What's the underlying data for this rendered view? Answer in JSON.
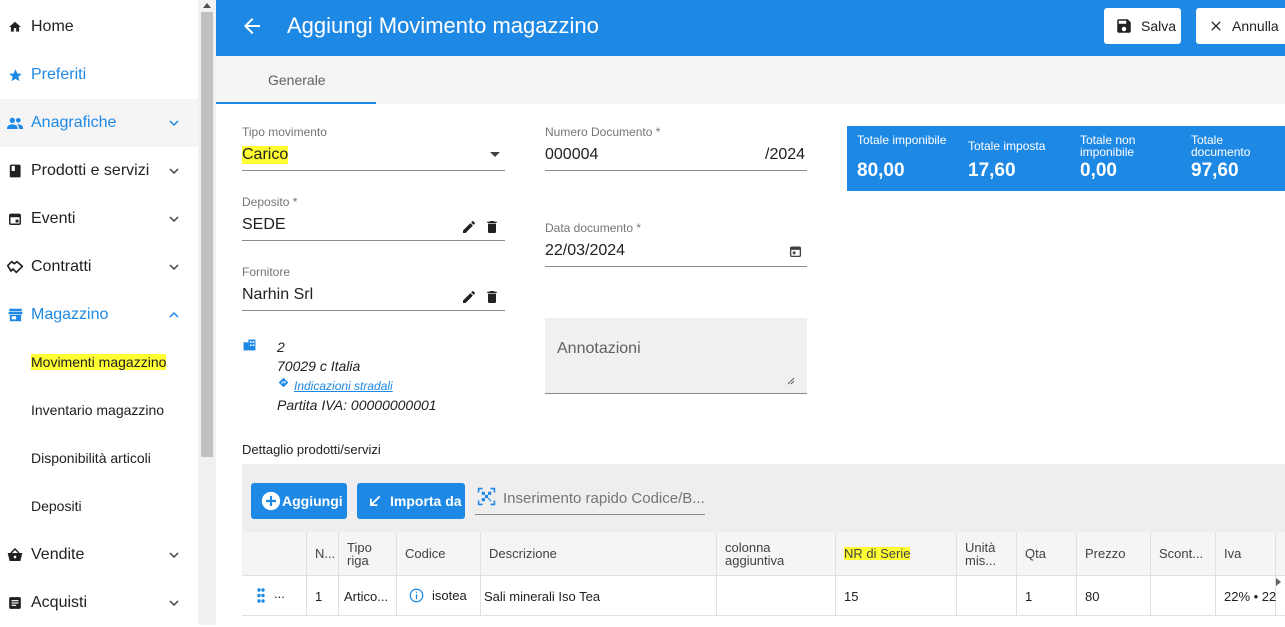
{
  "sidebar": {
    "items": [
      {
        "label": "Home"
      },
      {
        "label": "Preferiti"
      },
      {
        "label": "Anagrafiche"
      },
      {
        "label": "Prodotti e servizi"
      },
      {
        "label": "Eventi"
      },
      {
        "label": "Contratti"
      },
      {
        "label": "Magazzino"
      },
      {
        "label": "Vendite"
      },
      {
        "label": "Acquisti"
      }
    ],
    "subitems": [
      {
        "label": "Movimenti magazzino"
      },
      {
        "label": "Inventario magazzino"
      },
      {
        "label": "Disponibilità articoli"
      },
      {
        "label": "Depositi"
      }
    ]
  },
  "header": {
    "title": "Aggiungi Movimento magazzino",
    "save_label": "Salva",
    "cancel_label": "Annulla"
  },
  "tabs": [
    {
      "label": "Generale"
    }
  ],
  "form": {
    "tipo_movimento": {
      "label": "Tipo movimento",
      "value": "Carico"
    },
    "deposito": {
      "label": "Deposito *",
      "value": "SEDE"
    },
    "fornitore": {
      "label": "Fornitore",
      "value": "Narhin Srl"
    },
    "numero_documento": {
      "label": "Numero Documento *",
      "value": "000004",
      "suffix": "/2024"
    },
    "data_documento": {
      "label": "Data documento *",
      "value": "22/03/2024"
    },
    "annotazioni": {
      "placeholder": "Annotazioni"
    },
    "address": {
      "line1": "2",
      "line2": "70029 c Italia",
      "directions": "Indicazioni stradali",
      "vat": "Partita IVA: 00000000001"
    }
  },
  "totals": [
    {
      "label": "Totale imponibile",
      "value": "80,00"
    },
    {
      "label": "Totale imposta",
      "value": "17,60"
    },
    {
      "label": "Totale non imponibile",
      "value": "0,00"
    },
    {
      "label": "Totale documento",
      "value": "97,60"
    }
  ],
  "detail": {
    "title": "Dettaglio prodotti/servizi",
    "add_label": "Aggiungi",
    "import_label": "Importa da",
    "quick_placeholder": "Inserimento rapido Codice/B...",
    "columns": [
      "N...",
      "Tipo riga",
      "Codice",
      "Descrizione",
      "colonna aggiuntiva",
      "NR di Serie",
      "Unità mis...",
      "Qta",
      "Prezzo",
      "Scont...",
      "Iva"
    ],
    "rows": [
      {
        "handle": "...",
        "n": "1",
        "tipo": "Artico...",
        "codice": "isotea",
        "descrizione": "Sali minerali Iso Tea",
        "colonna": "",
        "serie": "15",
        "unita": "",
        "qta": "1",
        "prezzo": "80",
        "sconto": "",
        "iva": "22% • 22"
      }
    ]
  },
  "colors": {
    "primary": "#1e88e5",
    "highlight": "#ffff33"
  }
}
